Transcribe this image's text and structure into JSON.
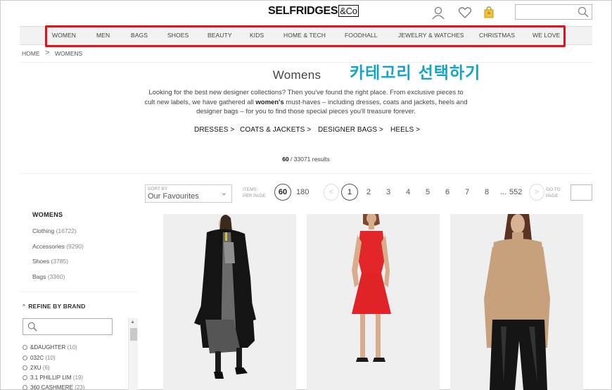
{
  "header": {
    "logo": "SELFRIDGES",
    "logo_suffix": "&Co",
    "icons": [
      "account-icon",
      "wishlist-heart-icon",
      "shopping-bag-icon",
      "search-icon"
    ]
  },
  "nav": {
    "items": [
      "WOMEN",
      "MEN",
      "BAGS",
      "SHOES",
      "BEAUTY",
      "KIDS",
      "HOME & TECH",
      "FOODHALL",
      "JEWELRY & WATCHES",
      "CHRISTMAS",
      "WE LOVE"
    ]
  },
  "breadcrumb": {
    "home": "HOME",
    "separator": ">",
    "current": "WOMENS"
  },
  "annotation": {
    "text": "카테고리 선택하기",
    "color": "#15a3c7",
    "highlight_color": "#e1141b"
  },
  "page": {
    "title": "Womens",
    "intro_part1": "Looking for the best new designer collections? Then you've found the right place. From exclusive pieces to cult new labels, we have gathered all ",
    "intro_bold": "women's",
    "intro_part2": " must-haves – including dresses, coats and jackets, heels and designer bags – for you to find those special pieces you'll treasure forever.",
    "quick_links": [
      "DRESSES >",
      "COATS & JACKETS >",
      "DESIGNER BAGS >",
      "HEELS >"
    ],
    "results_shown": "60",
    "results_total": "/ 33071 results"
  },
  "toolbar": {
    "sort_label": "SORT BY",
    "sort_value": "Our Favourites",
    "items_per_page_label_1": "ITEMS",
    "items_per_page_label_2": "PER PAGE",
    "ipp_options": [
      "60",
      "180"
    ],
    "pages": [
      "1",
      "2",
      "3",
      "4",
      "5",
      "6",
      "7",
      "8",
      "...",
      "552"
    ],
    "prev": "<",
    "next": ">",
    "goto_label_1": "GO TO",
    "goto_label_2": "PAGE"
  },
  "sidebar": {
    "title": "WOMENS",
    "categories": [
      {
        "label": "Clothing",
        "count": "(16722)"
      },
      {
        "label": "Accessories",
        "count": "(9290)"
      },
      {
        "label": "Shoes",
        "count": "(3785)"
      },
      {
        "label": "Bags",
        "count": "(3360)"
      }
    ],
    "refine_title": "REFINE BY BRAND",
    "brand_search_placeholder": "",
    "brands": [
      {
        "label": "&DAUGHTER",
        "count": "(10)"
      },
      {
        "label": "032C",
        "count": "(10)"
      },
      {
        "label": "2XU",
        "count": "(6)"
      },
      {
        "label": "3.1 PHILLIP LIM",
        "count": "(19)"
      },
      {
        "label": "360 CASHMERE",
        "count": "(23)"
      }
    ]
  },
  "products": [
    {
      "name": "black-coat-look"
    },
    {
      "name": "red-dress-look"
    },
    {
      "name": "beige-turtleneck-look"
    }
  ]
}
